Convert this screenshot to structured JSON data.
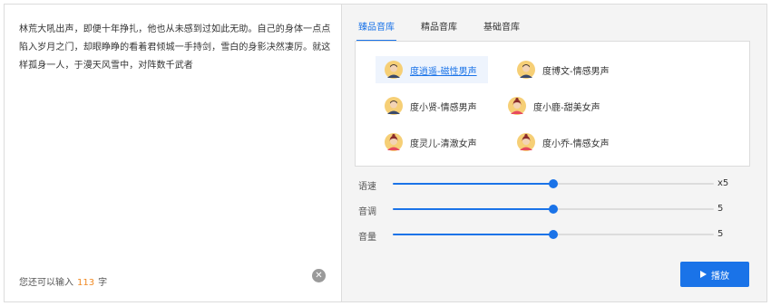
{
  "text_area": {
    "content": "林荒大吼出声，即便十年挣扎，他也从未感到过如此无助。自己的身体一点点陷入岁月之门，却眼睁睁的看着君倾城一手持剑，雪白的身影决然凄厉。就这样孤身一人，于漫天风雪中，对阵数千武者",
    "counter_prefix": "您还可以输入",
    "counter_value": "113",
    "counter_suffix": "字",
    "clear_icon": "close-circle-icon",
    "clear_glyph": "✕"
  },
  "tabs": [
    {
      "label": "臻品音库",
      "active": true
    },
    {
      "label": "精品音库",
      "active": false
    },
    {
      "label": "基础音库",
      "active": false
    }
  ],
  "voices": [
    {
      "label": "度逍遥-磁性男声",
      "gender": "male",
      "selected": true
    },
    {
      "label": "度博文-情感男声",
      "gender": "male",
      "selected": false
    },
    {
      "label": "度小贤-情感男声",
      "gender": "male",
      "selected": false
    },
    {
      "label": "度小鹿-甜美女声",
      "gender": "female",
      "selected": false
    },
    {
      "label": "度灵儿-清澈女声",
      "gender": "female",
      "selected": false
    },
    {
      "label": "度小乔-情感女声",
      "gender": "female",
      "selected": false
    }
  ],
  "sliders": [
    {
      "label": "语速",
      "value": "x5",
      "level": 0.5
    },
    {
      "label": "音调",
      "value": "5",
      "level": 0.5
    },
    {
      "label": "音量",
      "value": "5",
      "level": 0.5
    }
  ],
  "play_button": {
    "label": "播放",
    "icon": "play-icon"
  },
  "colors": {
    "accent": "#1a73e8",
    "counter": "#f08a24"
  }
}
